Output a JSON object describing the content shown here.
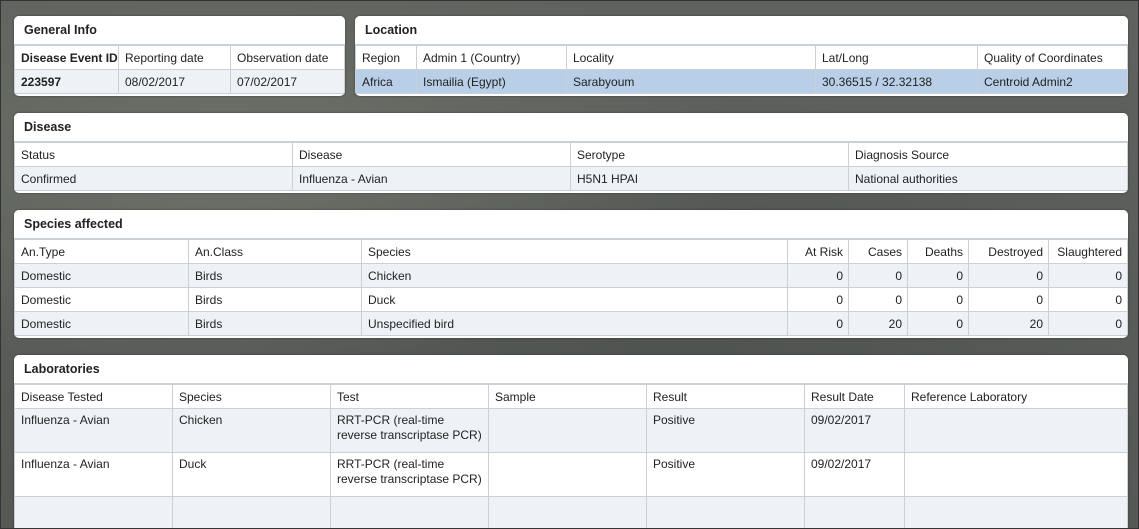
{
  "general_info": {
    "title": "General Info",
    "headers": [
      "Disease Event ID",
      "Reporting date",
      "Observation date"
    ],
    "values": [
      "223597",
      "08/02/2017",
      "07/02/2017"
    ]
  },
  "location": {
    "title": "Location",
    "headers": [
      "Region",
      "Admin 1 (Country)",
      "Locality",
      "Lat/Long",
      "Quality of Coordinates"
    ],
    "values": [
      "Africa",
      "Ismailia (Egypt)",
      "Sarabyoum",
      "30.36515 / 32.32138",
      "Centroid Admin2"
    ]
  },
  "disease": {
    "title": "Disease",
    "headers": [
      "Status",
      "Disease",
      "Serotype",
      "Diagnosis Source"
    ],
    "values": [
      "Confirmed",
      "Influenza - Avian",
      "H5N1 HPAI",
      "National authorities"
    ]
  },
  "species": {
    "title": "Species affected",
    "headers": [
      "An.Type",
      "An.Class",
      "Species",
      "At Risk",
      "Cases",
      "Deaths",
      "Destroyed",
      "Slaughtered"
    ],
    "rows": [
      [
        "Domestic",
        "Birds",
        "Chicken",
        "0",
        "0",
        "0",
        "0",
        "0"
      ],
      [
        "Domestic",
        "Birds",
        "Duck",
        "0",
        "0",
        "0",
        "0",
        "0"
      ],
      [
        "Domestic",
        "Birds",
        "Unspecified bird",
        "0",
        "20",
        "0",
        "20",
        "0"
      ]
    ]
  },
  "laboratories": {
    "title": "Laboratories",
    "headers": [
      "Disease Tested",
      "Species",
      "Test",
      "Sample",
      "Result",
      "Result Date",
      "Reference Laboratory"
    ],
    "rows": [
      [
        "Influenza - Avian",
        "Chicken",
        "RRT-PCR (real-time reverse transcriptase PCR)",
        "",
        "Positive",
        "09/02/2017",
        ""
      ],
      [
        "Influenza - Avian",
        "Duck",
        "RRT-PCR (real-time reverse transcriptase PCR)",
        "",
        "Positive",
        "09/02/2017",
        ""
      ]
    ]
  }
}
